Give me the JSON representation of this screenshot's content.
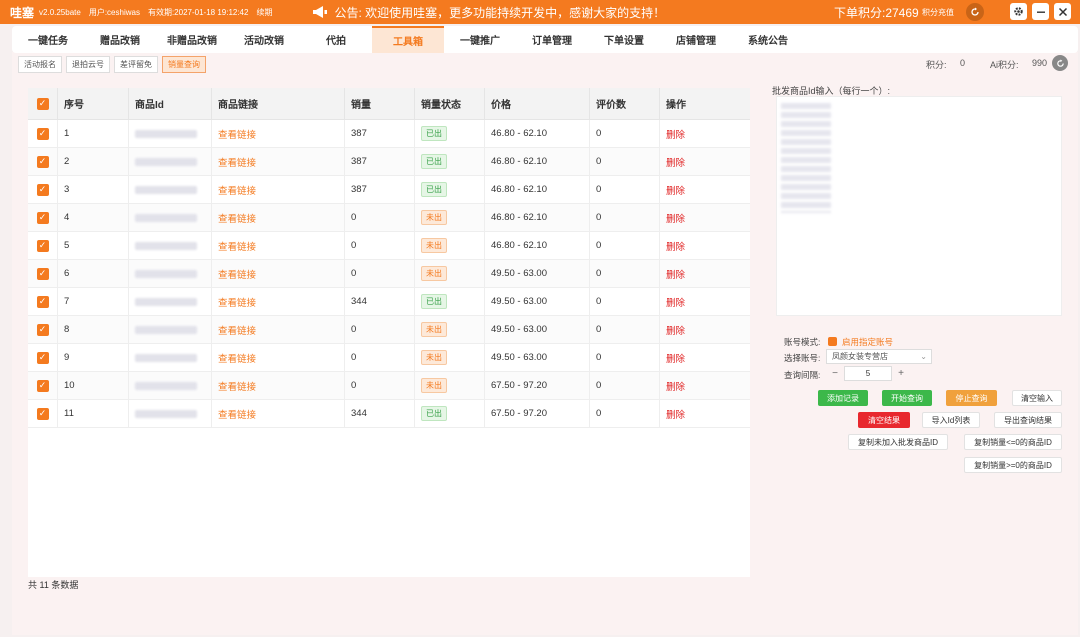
{
  "app": {
    "name": "哇塞",
    "version": "v2.0.25bate",
    "user": "用户:ceshiwas",
    "expire": "有效期:2027-01-18 19:12:42",
    "renew": "续期",
    "notice": "公告: 欢迎使用哇塞，更多功能持续开发中，感谢大家的支持！",
    "points": "下单积分:27469",
    "recharge": "积分充值"
  },
  "tabs": [
    "一键任务",
    "赠品改销",
    "非赠品改销",
    "活动改销",
    "代拍",
    "工具箱",
    "一键推广",
    "订单管理",
    "下单设置",
    "店铺管理",
    "系统公告"
  ],
  "subtabs": [
    "活动报名",
    "退拍云号",
    "差评留免",
    "销量查询"
  ],
  "score": {
    "label": "积分:",
    "value": "0",
    "ai_label": "Ai积分:",
    "ai_value": "990"
  },
  "table": {
    "headers": [
      "序号",
      "商品Id",
      "商品链接",
      "销量",
      "销量状态",
      "价格",
      "评价数",
      "操作"
    ],
    "link_text": "查看链接",
    "delete_text": "删除",
    "rows": [
      {
        "no": "1",
        "sales": "387",
        "status": "已出",
        "price": "46.80 - 62.10",
        "reviews": "0"
      },
      {
        "no": "2",
        "sales": "387",
        "status": "已出",
        "price": "46.80 - 62.10",
        "reviews": "0"
      },
      {
        "no": "3",
        "sales": "387",
        "status": "已出",
        "price": "46.80 - 62.10",
        "reviews": "0"
      },
      {
        "no": "4",
        "sales": "0",
        "status": "未出",
        "price": "46.80 - 62.10",
        "reviews": "0"
      },
      {
        "no": "5",
        "sales": "0",
        "status": "未出",
        "price": "46.80 - 62.10",
        "reviews": "0"
      },
      {
        "no": "6",
        "sales": "0",
        "status": "未出",
        "price": "49.50 - 63.00",
        "reviews": "0"
      },
      {
        "no": "7",
        "sales": "344",
        "status": "已出",
        "price": "49.50 - 63.00",
        "reviews": "0"
      },
      {
        "no": "8",
        "sales": "0",
        "status": "未出",
        "price": "49.50 - 63.00",
        "reviews": "0"
      },
      {
        "no": "9",
        "sales": "0",
        "status": "未出",
        "price": "49.50 - 63.00",
        "reviews": "0"
      },
      {
        "no": "10",
        "sales": "0",
        "status": "未出",
        "price": "67.50 - 97.20",
        "reviews": "0"
      },
      {
        "no": "11",
        "sales": "344",
        "status": "已出",
        "price": "67.50 - 97.20",
        "reviews": "0"
      }
    ],
    "total": "共 11 条数据"
  },
  "right": {
    "input_label": "批发商品Id输入（每行一个）:",
    "account_mode_label": "账号模式:",
    "account_mode_option": "启用指定账号",
    "select_account_label": "选择账号:",
    "select_account_value": "凤颜女装专营店",
    "interval_label": "查询间隔:",
    "interval_value": "5",
    "buttons": {
      "add_record": "添加记录",
      "start_query": "开始查询",
      "stop_query": "停止查询",
      "clear_input": "清空输入",
      "clear_result": "清空结果",
      "import_id": "导入Id列表",
      "export_result": "导出查询结果",
      "copy_not_added": "复制未加入批发商品ID",
      "copy_le0": "复制销量<=0的商品ID",
      "copy_ge0": "复制销量>=0的商品ID"
    }
  },
  "colors": {
    "accent": "#f47a1f",
    "green": "#3cb84a",
    "red": "#e8282e",
    "orange_btn": "#f0a13c"
  }
}
